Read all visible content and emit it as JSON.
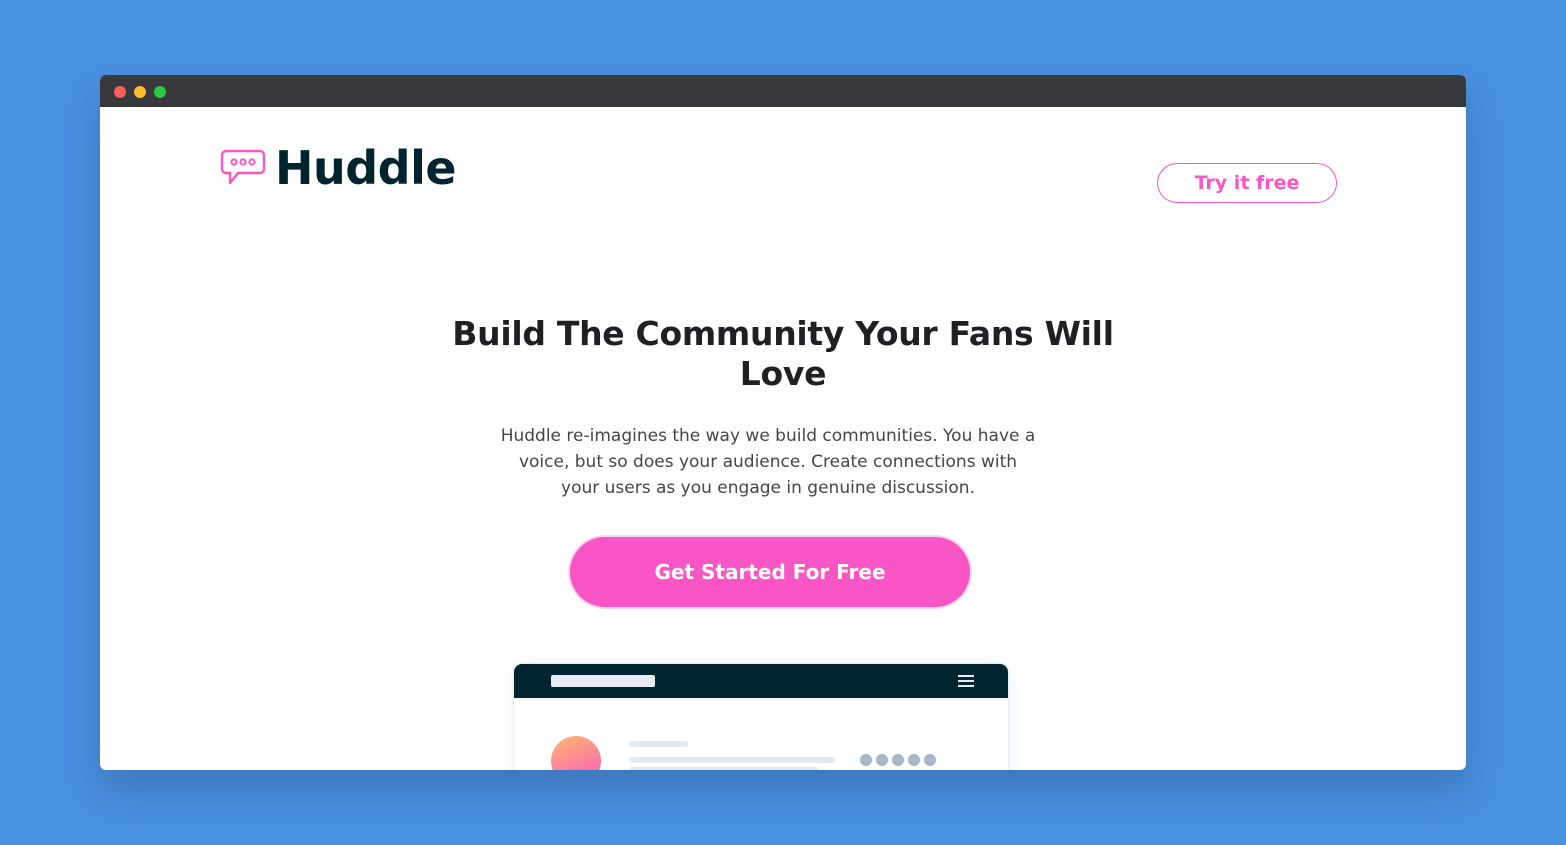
{
  "app": {
    "name": "Huddle",
    "logo_icon": "chat-bubble-icon",
    "accent_color": "#fa55c4",
    "dark_color": "#00252e",
    "background_color": "#4a90e2"
  },
  "window": {
    "controls": [
      "close",
      "minimize",
      "maximize"
    ]
  },
  "header": {
    "try_label": "Try it free"
  },
  "hero": {
    "title": "Build The Community Your Fans Will Love",
    "description": "Huddle re-imagines the way we build communities. You have a voice, but so does your audience. Create connections with your users as you engage in genuine discussion.",
    "cta_label": "Get Started For Free"
  },
  "mockup": {
    "menu_icon": "hamburger-menu-icon"
  }
}
